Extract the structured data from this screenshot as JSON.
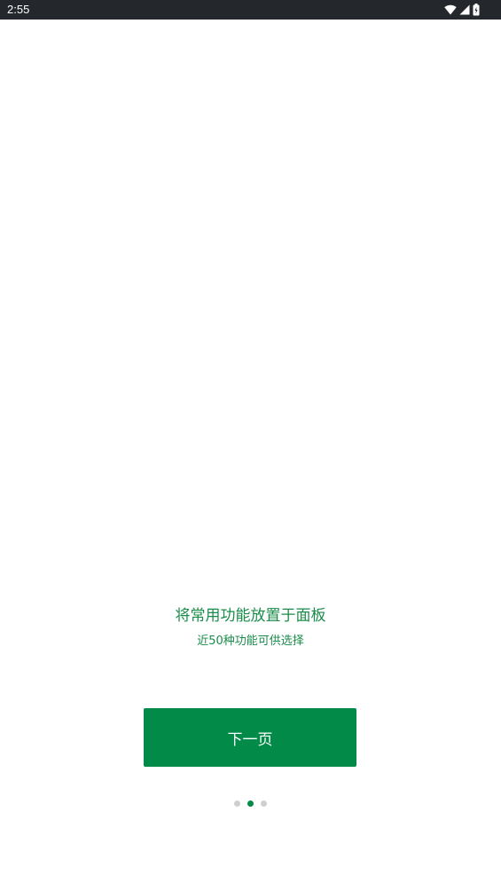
{
  "status_bar": {
    "time": "2:55",
    "icons": [
      "wifi-icon",
      "cell-signal-icon",
      "battery-icon"
    ]
  },
  "onboarding": {
    "title": "将常用功能放置于面板",
    "subtitle": "近50种功能可供选择",
    "next_label": "下一页",
    "page_count": 3,
    "active_page_index": 1
  },
  "colors": {
    "status_bar_bg": "#24282c",
    "accent": "#028a48",
    "text_accent": "#1a8c4a",
    "dot_inactive": "#cfcfcf",
    "background": "#ffffff"
  }
}
